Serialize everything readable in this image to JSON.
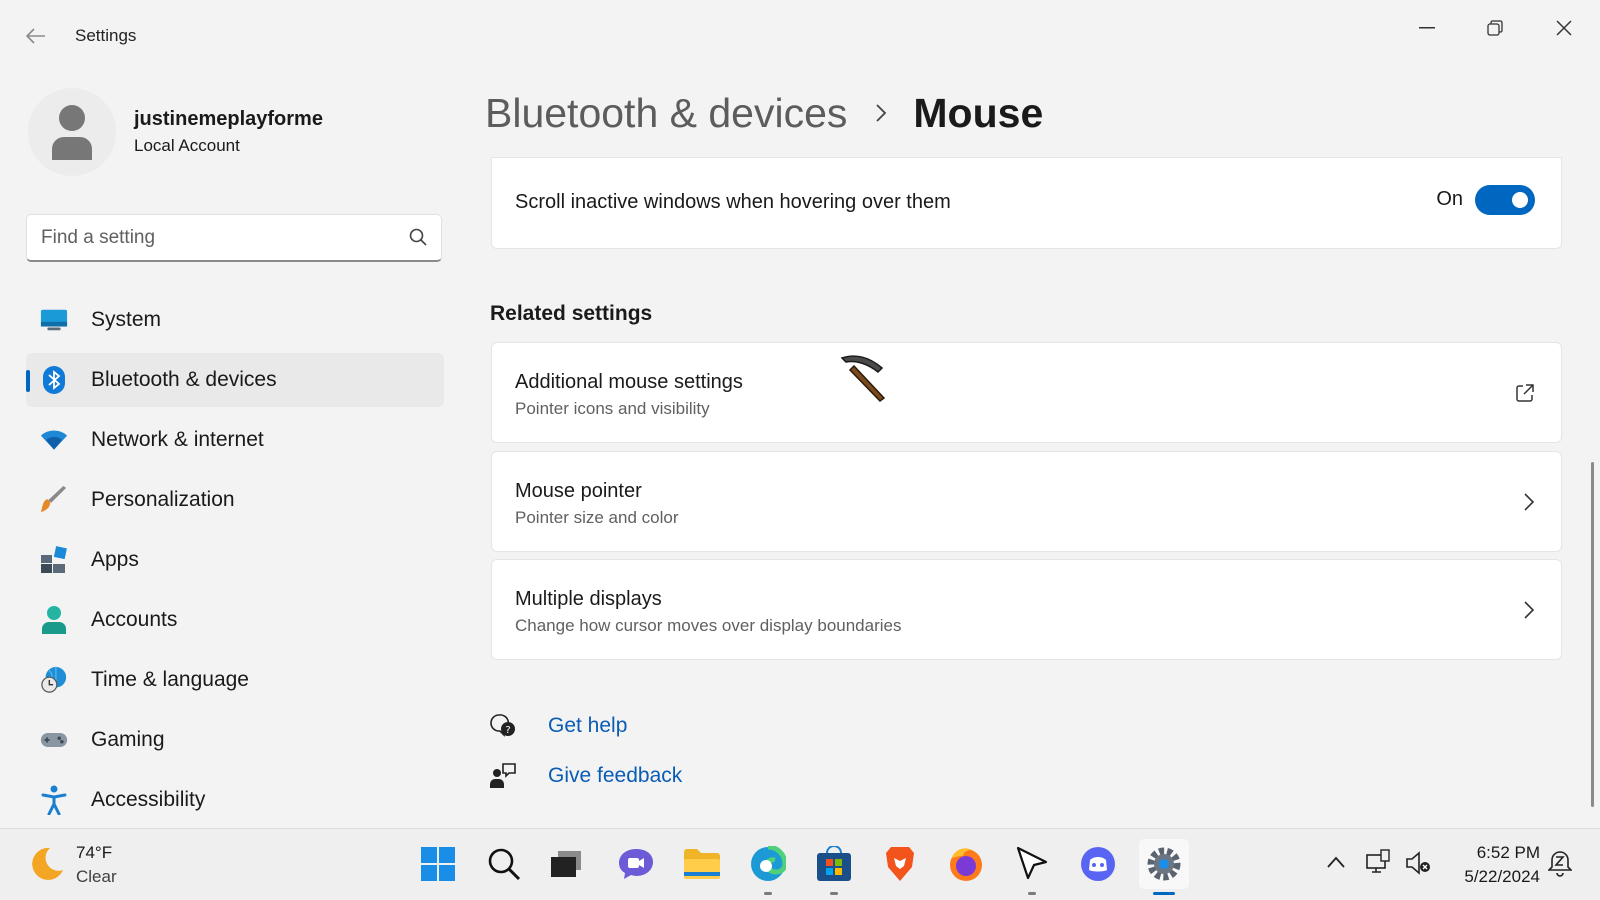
{
  "window": {
    "title": "Settings",
    "controls": [
      "minimize",
      "restore",
      "close"
    ]
  },
  "profile": {
    "name": "justinemeplayforme",
    "account_type": "Local Account"
  },
  "search": {
    "placeholder": "Find a setting"
  },
  "sidebar": {
    "items": [
      {
        "label": "System",
        "icon": "system-icon",
        "selected": false
      },
      {
        "label": "Bluetooth & devices",
        "icon": "bluetooth-icon",
        "selected": true
      },
      {
        "label": "Network & internet",
        "icon": "wifi-icon",
        "selected": false
      },
      {
        "label": "Personalization",
        "icon": "brush-icon",
        "selected": false
      },
      {
        "label": "Apps",
        "icon": "apps-icon",
        "selected": false
      },
      {
        "label": "Accounts",
        "icon": "accounts-icon",
        "selected": false
      },
      {
        "label": "Time & language",
        "icon": "time-language-icon",
        "selected": false
      },
      {
        "label": "Gaming",
        "icon": "gamepad-icon",
        "selected": false
      },
      {
        "label": "Accessibility",
        "icon": "accessibility-icon",
        "selected": false
      }
    ]
  },
  "breadcrumb": {
    "parent": "Bluetooth & devices",
    "current": "Mouse"
  },
  "scroll_inactive": {
    "label": "Scroll inactive windows when hovering over them",
    "state": "On",
    "enabled": true
  },
  "related": {
    "title": "Related settings",
    "items": [
      {
        "title": "Additional mouse settings",
        "subtitle": "Pointer icons and visibility",
        "action": "external-link-icon"
      },
      {
        "title": "Mouse pointer",
        "subtitle": "Pointer size and color",
        "action": "chevron-right-icon"
      },
      {
        "title": "Multiple displays",
        "subtitle": "Change how cursor moves over display boundaries",
        "action": "chevron-right-icon"
      }
    ]
  },
  "help_links": {
    "get_help": "Get help",
    "give_feedback": "Give feedback"
  },
  "taskbar": {
    "weather": {
      "temp": "74°F",
      "desc": "Clear"
    },
    "apps": [
      "start",
      "search",
      "task-view",
      "chat",
      "file-explorer",
      "edge",
      "store",
      "brave",
      "firefox",
      "cursor-app",
      "discord",
      "settings"
    ],
    "clock": {
      "time": "6:52 PM",
      "date": "5/22/2024"
    }
  },
  "colors": {
    "accent": "#0067c0",
    "link": "#0a5cb5",
    "background": "#f3f3f3"
  }
}
